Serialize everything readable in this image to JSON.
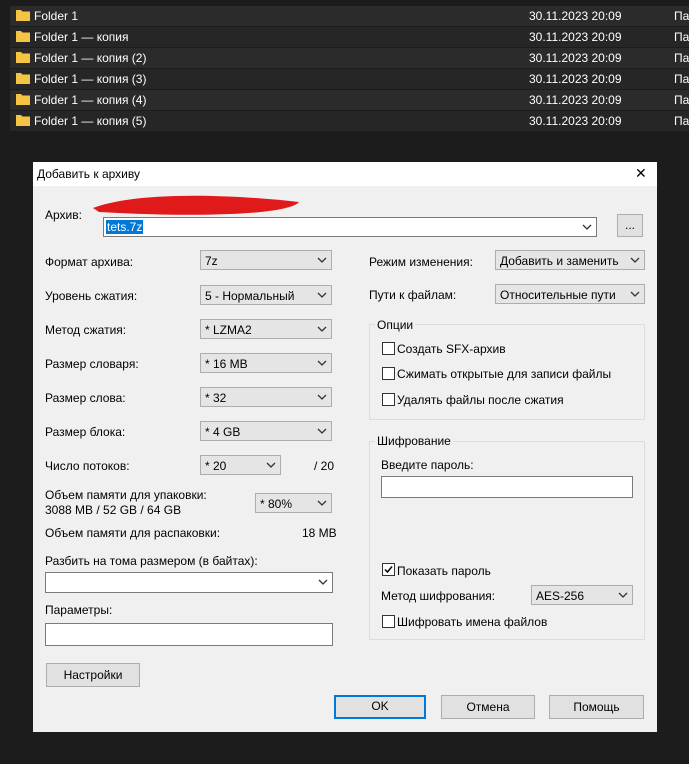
{
  "explorer": {
    "rows": [
      {
        "name": "Folder 1",
        "date": "30.11.2023 20:09",
        "type": "Па"
      },
      {
        "name": "Folder 1 — копия",
        "date": "30.11.2023 20:09",
        "type": "Па"
      },
      {
        "name": "Folder 1 — копия (2)",
        "date": "30.11.2023 20:09",
        "type": "Па"
      },
      {
        "name": "Folder 1 — копия (3)",
        "date": "30.11.2023 20:09",
        "type": "Па"
      },
      {
        "name": "Folder 1 — копия (4)",
        "date": "30.11.2023 20:09",
        "type": "Па"
      },
      {
        "name": "Folder 1 — копия (5)",
        "date": "30.11.2023 20:09",
        "type": "Па"
      }
    ]
  },
  "dialog": {
    "title": "Добавить к архиву",
    "close_glyph": "✕",
    "archive_label": "Архив:",
    "archive_value": "tets.7z",
    "browse_label": "...",
    "format_label": "Формат архива:",
    "format_value": "7z",
    "level_label": "Уровень сжатия:",
    "level_value": "5 - Нормальный",
    "method_label": "Метод сжатия:",
    "method_value": "*  LZMA2",
    "dict_label": "Размер словаря:",
    "dict_value": "*  16 MB",
    "word_label": "Размер слова:",
    "word_value": "*  32",
    "block_label": "Размер блока:",
    "block_value": "*  4 GB",
    "threads_label": "Число потоков:",
    "threads_value": "*  20",
    "threads_max": "/ 20",
    "mem_pack_label": "Объем памяти для упаковки:",
    "mem_pack_value": "3088 MB / 52 GB / 64 GB",
    "mem_pack_percent": "*  80%",
    "mem_unpack_label": "Объем памяти для распаковки:",
    "mem_unpack_value": "18 MB",
    "split_label": "Разбить на тома размером (в байтах):",
    "split_value": "",
    "params_label": "Параметры:",
    "params_value": "",
    "settings_button": "Настройки",
    "update_mode_label": "Режим изменения:",
    "update_mode_value": "Добавить и заменить",
    "paths_label": "Пути к файлам:",
    "paths_value": "Относительные пути",
    "options": {
      "title": "Опции",
      "sfx": "Создать SFX-архив",
      "sfx_checked": false,
      "open_files": "Сжимать открытые для записи файлы",
      "open_files_checked": false,
      "delete_after": "Удалять файлы после сжатия",
      "delete_after_checked": false
    },
    "encryption": {
      "title": "Шифрование",
      "password_label": "Введите пароль:",
      "password_value": "",
      "show_password": "Показать пароль",
      "show_password_checked": true,
      "method_label": "Метод шифрования:",
      "method_value": "AES-256",
      "encrypt_names": "Шифровать имена файлов",
      "encrypt_names_checked": false
    },
    "ok_button": "OK",
    "cancel_button": "Отмена",
    "help_button": "Помощь"
  },
  "colors": {
    "folder": "#f4c542",
    "selection": "#0078d7",
    "redaction": "#e0191b"
  }
}
